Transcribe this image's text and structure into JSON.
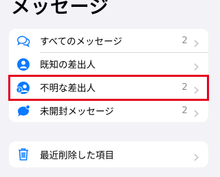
{
  "header": {
    "title": "メッセージ"
  },
  "filters": [
    {
      "label": "すべてのメッセージ",
      "count": "2",
      "icon": "bubbles-icon"
    },
    {
      "label": "既知の差出人",
      "count": "",
      "icon": "person-circle-icon"
    },
    {
      "label": "不明な差出人",
      "count": "2",
      "icon": "person-question-icon"
    },
    {
      "label": "未開封メッセージ",
      "count": "2",
      "icon": "bubble-unread-icon"
    }
  ],
  "trash": {
    "label": "最近削除した項目",
    "icon": "trash-icon"
  },
  "colors": {
    "accent": "#0a7aff",
    "highlight": "#e3001b",
    "background": "#f2f2f7"
  }
}
